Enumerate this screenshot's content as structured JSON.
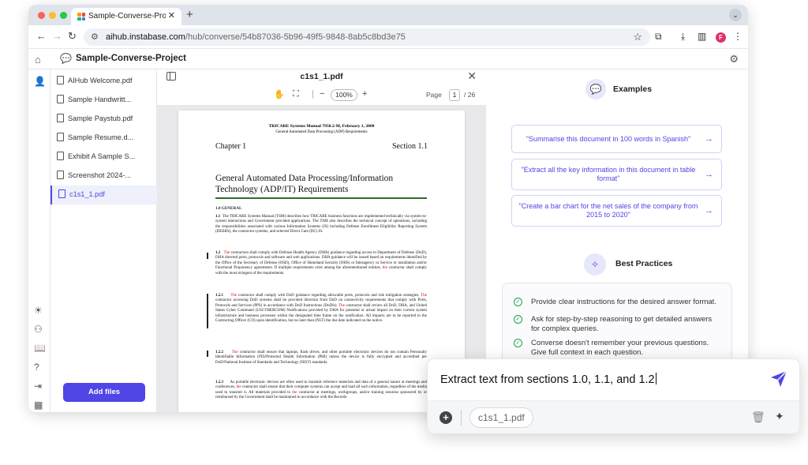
{
  "browser": {
    "tab_title": "Sample-Converse-Project - C",
    "tab_close": "✕",
    "new_tab": "+",
    "url_host": "aihub.instabase.com",
    "url_path": "/hub/converse/54b87036-5b96-49f5-9848-8ab5c8bd3e75",
    "profile_initial": "F"
  },
  "app": {
    "project_title": "Sample-Converse-Project"
  },
  "files": [
    {
      "name": "AIHub Welcome.pdf"
    },
    {
      "name": "Sample Handwritt..."
    },
    {
      "name": "Sample Paystub.pdf"
    },
    {
      "name": "Sample Resume.d..."
    },
    {
      "name": "Exhibit A Sample S..."
    },
    {
      "name": "Screenshot 2024-..."
    },
    {
      "name": "c1s1_1.pdf"
    }
  ],
  "add_files_label": "Add files",
  "viewer": {
    "title": "c1s1_1.pdf",
    "zoom": "100%",
    "page_label": "Page",
    "page_current": "1",
    "page_total": "/ 26"
  },
  "document": {
    "header1": "TRICARE Systems Manual 7950.2-M, February 1, 2008",
    "header2": "General Automated Data Processing (ADP) Requirements",
    "chapter": "Chapter 1",
    "section": "Section 1.1",
    "title": "General Automated Data Processing/Information Technology (ADP/IT) Requirements",
    "general": "1.0    GENERAL",
    "p11_num": "1.1",
    "p11": "The TRICARE Systems Manual (TSM) describes how TRICARE business functions are implemented technically via system-to-system interactions and Government provided applications. The TSM also describes the technical concept of operations, including the responsibilities associated with various Information Systems (IS) including Defense Enrollment Eligibility Reporting System (DEERS), the contractor systems, and selected Direct Care (DC) IS.",
    "p12_num": "1.2",
    "p12_red1": "The",
    "p12a": " contractors shall comply with Defense Health Agency (DHA) guidance regarding access to Department of Defense (DoD), DHA directed ports, protocols and software and web applications. DHA guidance will be issued based on requirements identified by the Office of the Secretary of Defense (OSD), Office of Homeland Security (OHS) or Interagency or Service or installation and/or Functional Proponency agreements. If multiple requirements exist among the aforementioned entities, ",
    "p12_red2": "the",
    "p12b": " contractor shall comply with the most stringent of the requirements.",
    "p121_num": "1.2.1",
    "p121_red1": "The",
    "p121a": " contractor shall comply with DoD guidance regarding allowable ports, protocols and risk mitigation strategies. ",
    "p121_red2": "The",
    "p121b": " contractor accessing DoD systems shall be provided direction from DoD on connectivity requirements that comply with Ports, Protocols and Services (PPS) in accordance with DoD Instructions (DoDIs). ",
    "p121_red3": "The",
    "p121c": " contractor shall review all DoD, DHA, and United States Cyber Command (USCYBERCOM) Notifications provided by DHA for potential or actual impact on their current system infrastructure and business processes within the designated time frame on the notification. All impacts are to be reported to the Contracting Officer (CO) upon identification, but no later than (NLT) the due date indicated on the notice.",
    "p122_num": "1.2.2",
    "p122_red1": "The",
    "p122a": " contractor shall ensure that laptops, flash drives, and other portable electronic devices do not contain Personally Identifiable Information (PII)/Protected Health Information (PHI) unless the device is fully encrypted and accredited per DoD/National Institute of Standards and Technology (NIST) standards.",
    "p123_num": "1.2.3",
    "p123a": "As portable electronic devices are often used to transmit reference materials and data of a general nature at meetings and conferences, ",
    "p123_red1": "the",
    "p123b": " contractor shall ensure that their computer systems can accept and load all such information, regardless of the media used to transmit it. All materials provided to ",
    "p123_red2": "the",
    "p123c": " contractor at meetings, workgroups, and/or training sessions sponsored by or reimbursed by the Government shall be maintained in accordance with the Records"
  },
  "examples": {
    "title": "Examples",
    "items": [
      {
        "text": "\"Summarise this document in 100 words in Spanish\""
      },
      {
        "text": "\"Extract all the key information in this document in table format\""
      },
      {
        "text": "\"Create a bar chart for the net sales of the company from 2015 to 2020\""
      }
    ],
    "arrow": "→"
  },
  "best_practices": {
    "title": "Best Practices",
    "items": [
      {
        "text": "Provide clear instructions for the desired answer format."
      },
      {
        "text": "Ask for step-by-step reasoning to get detailed answers for complex queries."
      },
      {
        "text": "Converse doesn't remember your previous questions. Give full context in each question."
      }
    ]
  },
  "composer": {
    "input_value": "Extract text from sections 1.0, 1.1, and 1.2",
    "chip": "c1s1_1.pdf",
    "plus": "+"
  },
  "colors": {
    "accent": "#4f46e5",
    "check": "#16a34a",
    "rule": "#2f6b2f"
  }
}
